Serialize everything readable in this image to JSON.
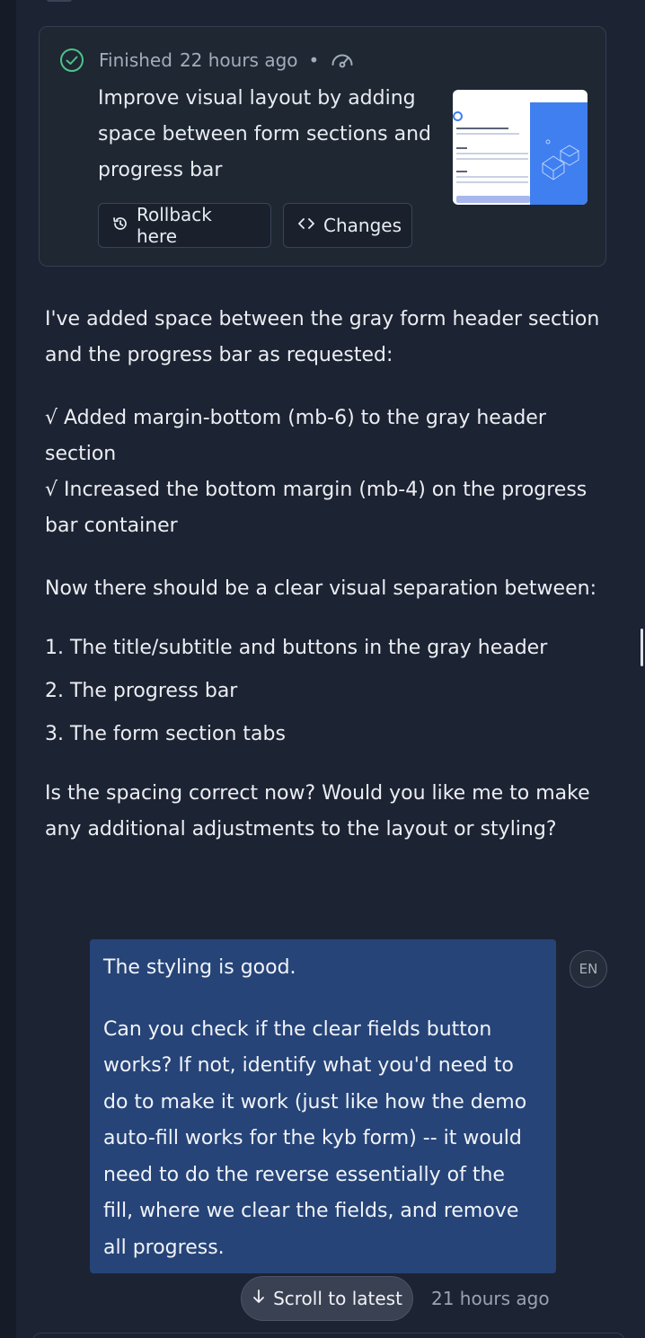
{
  "checkpoint": {
    "status": "Finished",
    "time": "22 hours ago",
    "separator": "•",
    "title": "Improve visual layout by adding space between form sections and progress bar",
    "rollback_label": "Rollback here",
    "changes_label": "Changes",
    "status_color": "#4cc38a"
  },
  "assistant_message": {
    "intro": "I've added space between the gray form header section and the progress bar as requested:",
    "changes": [
      "√ Added margin-bottom (mb-6) to the gray header section",
      "√ Increased the bottom margin (mb-4) on the progress bar container"
    ],
    "separation_intro": "Now there should be a clear visual separation between:",
    "list": [
      "1. The title/subtitle and buttons in the gray header",
      "2. The progress bar",
      "3. The form section tabs"
    ],
    "question": "Is the spacing correct now? Would you like me to make any additional adjustments to the layout or styling?"
  },
  "user_message": {
    "line1": "The styling is good.",
    "line2": "Can you check if the clear fields button works? If not, identify what you'd need to do to make it work (just like how the demo auto-fill works for the kyb form) -- it would need to do the reverse essentially of the fill, where we clear the fields, and remove all progress.",
    "language_badge": "EN",
    "bubble_color": "#264478"
  },
  "footer": {
    "scroll_label": "Scroll to latest",
    "time": "21 hours ago"
  },
  "icons": {
    "status": "check-circle-icon",
    "gauge": "gauge-icon",
    "rollback": "history-icon",
    "changes": "code-brackets-icon",
    "scroll": "arrow-down-icon"
  }
}
